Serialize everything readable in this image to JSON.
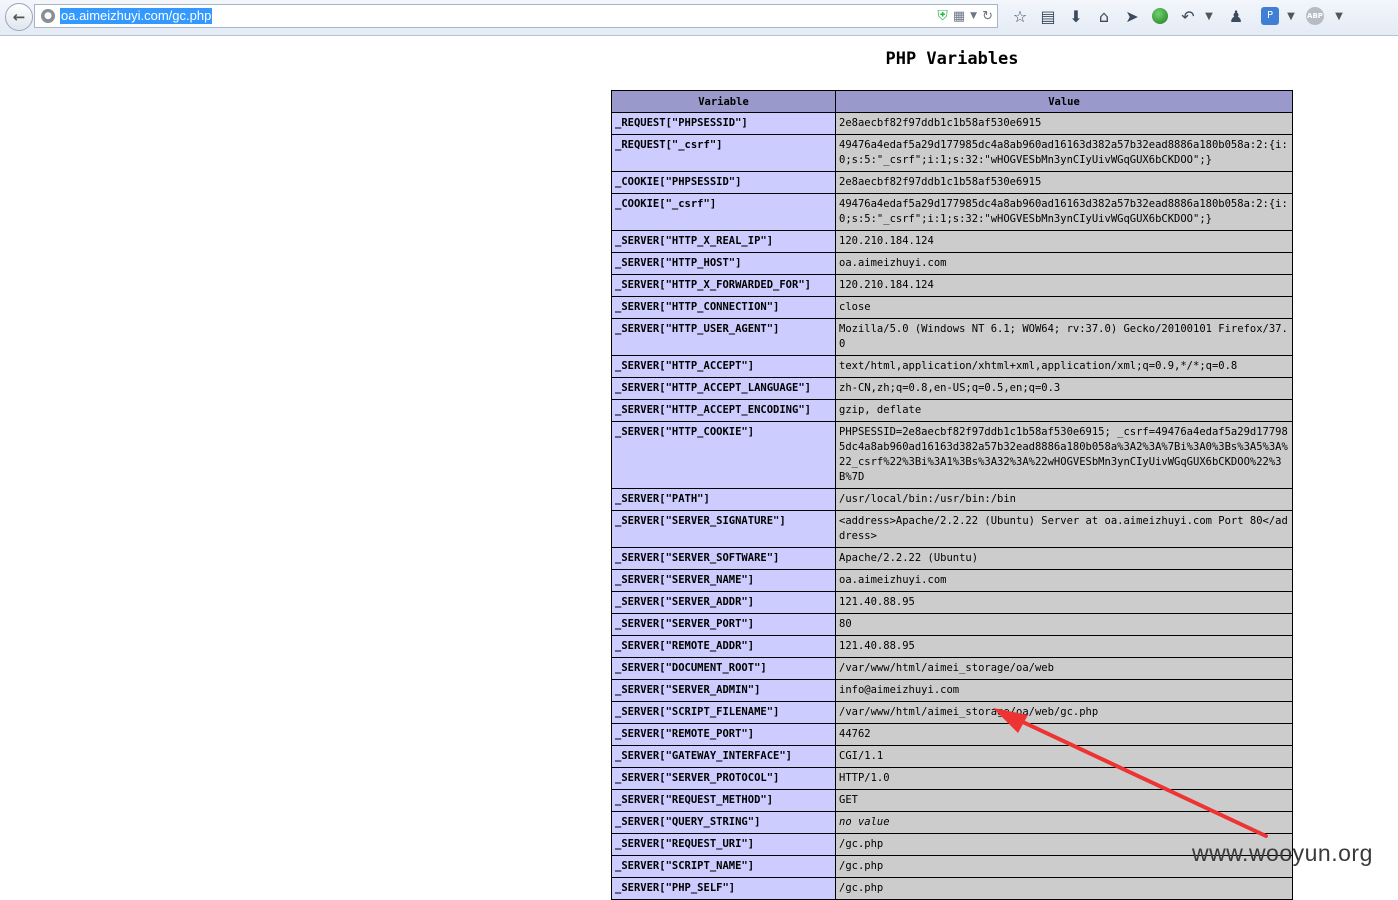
{
  "browser": {
    "url": "oa.aimeizhuyi.com/gc.php",
    "icons": [
      "back-icon",
      "globe-icon",
      "shield-icon",
      "qr-code-icon",
      "dropdown-icon",
      "reload-icon",
      "bookmark-star-icon",
      "clipboard-icon",
      "download-icon",
      "home-icon",
      "send-icon",
      "green-ball-icon",
      "undo-icon",
      "dropdown-icon",
      "user-icon",
      "translate-icon",
      "dropdown-icon",
      "adblock-icon",
      "dropdown-icon"
    ],
    "abp_label": "ABP"
  },
  "page": {
    "title": "PHP Variables",
    "table": {
      "headers": [
        "Variable",
        "Value"
      ],
      "rows": [
        [
          "_REQUEST[\"PHPSESSID\"]",
          "2e8aecbf82f97ddb1c1b58af530e6915"
        ],
        [
          "_REQUEST[\"_csrf\"]",
          "49476a4edaf5a29d177985dc4a8ab960ad16163d382a57b32ead8886a180b058a:2:{i:0;s:5:\"_csrf\";i:1;s:32:\"wHOGVESbMn3ynCIyUivWGqGUX6bCKDOO\";}"
        ],
        [
          "_COOKIE[\"PHPSESSID\"]",
          "2e8aecbf82f97ddb1c1b58af530e6915"
        ],
        [
          "_COOKIE[\"_csrf\"]",
          "49476a4edaf5a29d177985dc4a8ab960ad16163d382a57b32ead8886a180b058a:2:{i:0;s:5:\"_csrf\";i:1;s:32:\"wHOGVESbMn3ynCIyUivWGqGUX6bCKDOO\";}"
        ],
        [
          "_SERVER[\"HTTP_X_REAL_IP\"]",
          "120.210.184.124"
        ],
        [
          "_SERVER[\"HTTP_HOST\"]",
          "oa.aimeizhuyi.com"
        ],
        [
          "_SERVER[\"HTTP_X_FORWARDED_FOR\"]",
          "120.210.184.124"
        ],
        [
          "_SERVER[\"HTTP_CONNECTION\"]",
          "close"
        ],
        [
          "_SERVER[\"HTTP_USER_AGENT\"]",
          "Mozilla/5.0 (Windows NT 6.1; WOW64; rv:37.0) Gecko/20100101 Firefox/37.0"
        ],
        [
          "_SERVER[\"HTTP_ACCEPT\"]",
          "text/html,application/xhtml+xml,application/xml;q=0.9,*/*;q=0.8"
        ],
        [
          "_SERVER[\"HTTP_ACCEPT_LANGUAGE\"]",
          "zh-CN,zh;q=0.8,en-US;q=0.5,en;q=0.3"
        ],
        [
          "_SERVER[\"HTTP_ACCEPT_ENCODING\"]",
          "gzip, deflate"
        ],
        [
          "_SERVER[\"HTTP_COOKIE\"]",
          "PHPSESSID=2e8aecbf82f97ddb1c1b58af530e6915; _csrf=49476a4edaf5a29d177985dc4a8ab960ad16163d382a57b32ead8886a180b058a%3A2%3A%7Bi%3A0%3Bs%3A5%3A%22_csrf%22%3Bi%3A1%3Bs%3A32%3A%22wHOGVESbMn3ynCIyUivWGqGUX6bCKDOO%22%3B%7D"
        ],
        [
          "_SERVER[\"PATH\"]",
          "/usr/local/bin:/usr/bin:/bin"
        ],
        [
          "_SERVER[\"SERVER_SIGNATURE\"]",
          "<address>Apache/2.2.22 (Ubuntu) Server at oa.aimeizhuyi.com Port 80</address>"
        ],
        [
          "_SERVER[\"SERVER_SOFTWARE\"]",
          "Apache/2.2.22 (Ubuntu)"
        ],
        [
          "_SERVER[\"SERVER_NAME\"]",
          "oa.aimeizhuyi.com"
        ],
        [
          "_SERVER[\"SERVER_ADDR\"]",
          "121.40.88.95"
        ],
        [
          "_SERVER[\"SERVER_PORT\"]",
          "80"
        ],
        [
          "_SERVER[\"REMOTE_ADDR\"]",
          "121.40.88.95"
        ],
        [
          "_SERVER[\"DOCUMENT_ROOT\"]",
          "/var/www/html/aimei_storage/oa/web"
        ],
        [
          "_SERVER[\"SERVER_ADMIN\"]",
          "info@aimeizhuyi.com"
        ],
        [
          "_SERVER[\"SCRIPT_FILENAME\"]",
          "/var/www/html/aimei_storage/oa/web/gc.php"
        ],
        [
          "_SERVER[\"REMOTE_PORT\"]",
          "44762"
        ],
        [
          "_SERVER[\"GATEWAY_INTERFACE\"]",
          "CGI/1.1"
        ],
        [
          "_SERVER[\"SERVER_PROTOCOL\"]",
          "HTTP/1.0"
        ],
        [
          "_SERVER[\"REQUEST_METHOD\"]",
          "GET"
        ],
        [
          "_SERVER[\"QUERY_STRING\"]",
          "no value"
        ],
        [
          "_SERVER[\"REQUEST_URI\"]",
          "/gc.php"
        ],
        [
          "_SERVER[\"SCRIPT_NAME\"]",
          "/gc.php"
        ],
        [
          "_SERVER[\"PHP_SELF\"]",
          "/gc.php"
        ]
      ]
    }
  },
  "annotation": {
    "arrow_color": "#ee3333",
    "watermark": "www.wooyun.org"
  }
}
